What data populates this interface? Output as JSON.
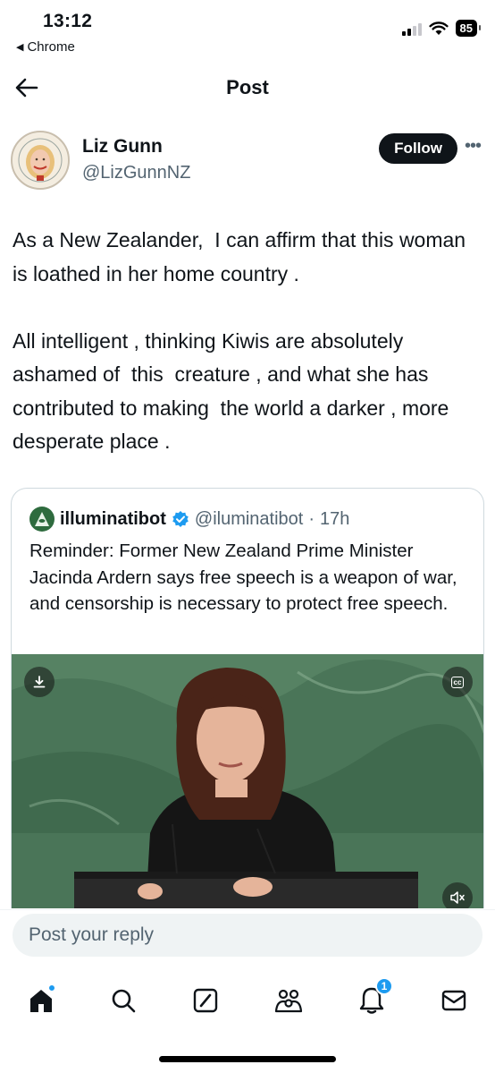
{
  "status_bar": {
    "time": "13:12",
    "back_app": "Chrome",
    "battery": "85"
  },
  "header": {
    "title": "Post"
  },
  "author": {
    "name": "Liz Gunn",
    "handle": "@LizGunnNZ",
    "follow_label": "Follow"
  },
  "post": {
    "text": "As a New Zealander,  I can affirm that this woman is loathed in her home country .\n\nAll intelligent , thinking Kiwis are absolutely ashamed of  this  creature , and what she has contributed to making  the world a darker , more desperate place ."
  },
  "quote": {
    "name": "illuminatibot",
    "handle": "@iluminatibot",
    "separator": "·",
    "time": "17h",
    "text": "Reminder: Former New Zealand Prime Minister Jacinda Ardern says free speech is a weapon of war, and censorship is necessary to protect free speech."
  },
  "video": {
    "cc_label": "cc"
  },
  "reply": {
    "placeholder": "Post your reply"
  },
  "nav": {
    "notifications_count": "1"
  },
  "colors": {
    "accent": "#1d9bf0",
    "text_primary": "#0f1419",
    "text_secondary": "#536471",
    "verified": "#1d9bf0"
  }
}
